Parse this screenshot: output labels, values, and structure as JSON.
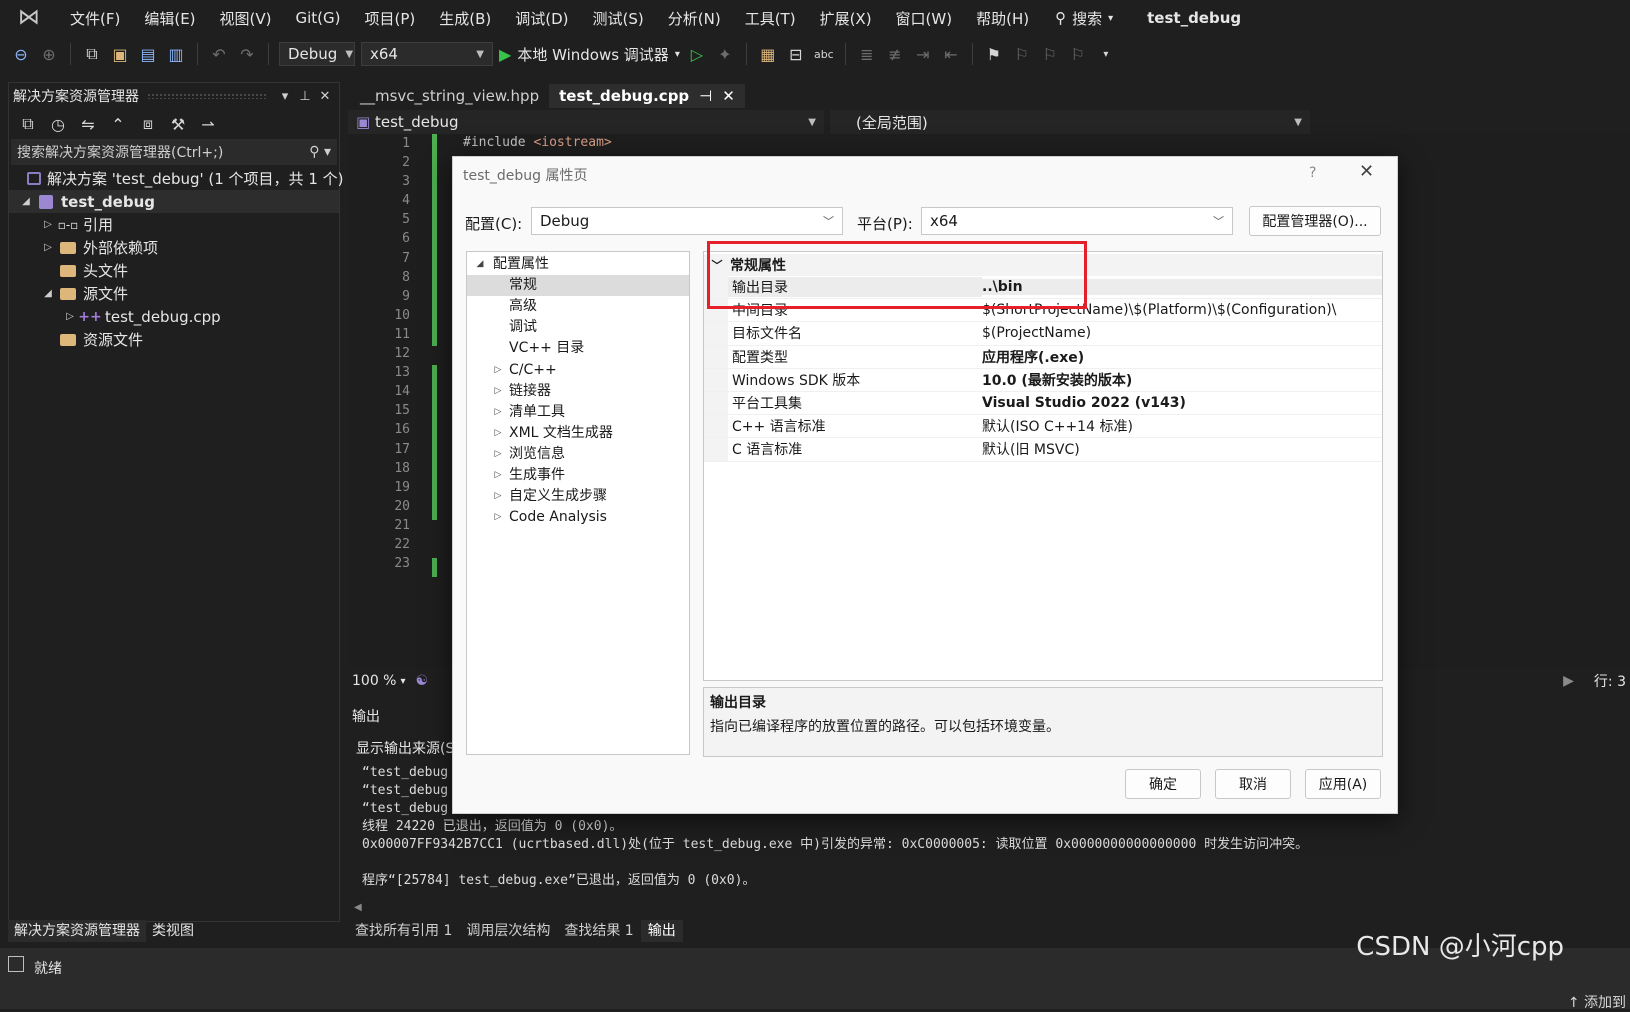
{
  "menubar": {
    "items": [
      "文件(F)",
      "编辑(E)",
      "视图(V)",
      "Git(G)",
      "项目(P)",
      "生成(B)",
      "调试(D)",
      "测试(S)",
      "分析(N)",
      "工具(T)",
      "扩展(X)",
      "窗口(W)",
      "帮助(H)"
    ],
    "search_label": "搜索",
    "solution_title": "test_debug"
  },
  "toolbar": {
    "config": "Debug",
    "platform": "x64",
    "run_label": "本地 Windows 调试器"
  },
  "solution_explorer": {
    "title": "解决方案资源管理器",
    "search_placeholder": "搜索解决方案资源管理器(Ctrl+;)",
    "solution_row": "解决方案 'test_debug' (1 个项目，共 1 个)",
    "project": "test_debug",
    "refs": "引用",
    "external": "外部依赖项",
    "headers": "头文件",
    "sources": "源文件",
    "cpp_file": "test_debug.cpp",
    "resources": "资源文件",
    "bottom_tabs": [
      "解决方案资源管理器",
      "类视图"
    ]
  },
  "editor": {
    "tabs": [
      "__msvc_string_view.hpp",
      "test_debug.cpp"
    ],
    "nav_left": "test_debug",
    "nav_right": "(全局范围)",
    "line_numbers": [
      "1",
      "2",
      "3",
      "4",
      "5",
      "6",
      "7",
      "8",
      "9",
      "10",
      "11",
      "12",
      "13",
      "14",
      "15",
      "16",
      "17",
      "18",
      "19",
      "20",
      "21",
      "22",
      "23"
    ],
    "first_line_kw": "#include",
    "first_line_str": "<iostream>",
    "zoom": "100 %",
    "row_indicator": "行: 3"
  },
  "output": {
    "title": "输出",
    "source_label": "显示输出来源(S)",
    "lines": [
      "“test_debug",
      "“test_debug",
      "“test_debug",
      "线程 24220 已退出，返回值为 0 (0x0)。",
      "0x00007FF9342B7CC1 (ucrtbased.dll)处(位于 test_debug.exe 中)引发的异常: 0xC0000005: 读取位置 0x0000000000000000 时发生访问冲突。",
      "",
      "程序“[25784] test_debug.exe”已退出，返回值为 0 (0x0)。"
    ],
    "tabs": [
      "查找所有引用 1",
      "调用层次结构",
      "查找结果 1",
      "输出"
    ]
  },
  "statusbar": {
    "ready": "就绪",
    "watermark": "CSDN @小河cpp",
    "add_to": "↑ 添加到"
  },
  "dialog": {
    "title": "test_debug 属性页",
    "help": "?",
    "config_label": "配置(C):",
    "config_value": "Debug",
    "platform_label": "平台(P):",
    "platform_value": "x64",
    "config_manager": "配置管理器(O)...",
    "tree": {
      "root": "配置属性",
      "items": [
        "常规",
        "高级",
        "调试",
        "VC++ 目录"
      ],
      "expandable": [
        "C/C++",
        "链接器",
        "清单工具",
        "XML 文档生成器",
        "浏览信息",
        "生成事件",
        "自定义生成步骤",
        "Code Analysis"
      ]
    },
    "grid": {
      "section": "常规属性",
      "rows": [
        {
          "name": "输出目录",
          "value": "..\\bin",
          "bold": true
        },
        {
          "name": "中间目录",
          "value": "$(ShortProjectName)\\$(Platform)\\$(Configuration)\\",
          "bold": false
        },
        {
          "name": "目标文件名",
          "value": "$(ProjectName)",
          "bold": false
        },
        {
          "name": "配置类型",
          "value": "应用程序(.exe)",
          "bold": true
        },
        {
          "name": "Windows SDK 版本",
          "value": "10.0 (最新安装的版本)",
          "bold": true
        },
        {
          "name": "平台工具集",
          "value": "Visual Studio 2022 (v143)",
          "bold": true
        },
        {
          "name": "C++ 语言标准",
          "value": "默认(ISO C++14 标准)",
          "bold": false
        },
        {
          "name": "C 语言标准",
          "value": "默认(旧 MSVC)",
          "bold": false
        }
      ]
    },
    "desc_title": "输出目录",
    "desc_text": "指向已编译程序的放置位置的路径。可以包括环境变量。",
    "ok": "确定",
    "cancel": "取消",
    "apply": "应用(A)"
  }
}
